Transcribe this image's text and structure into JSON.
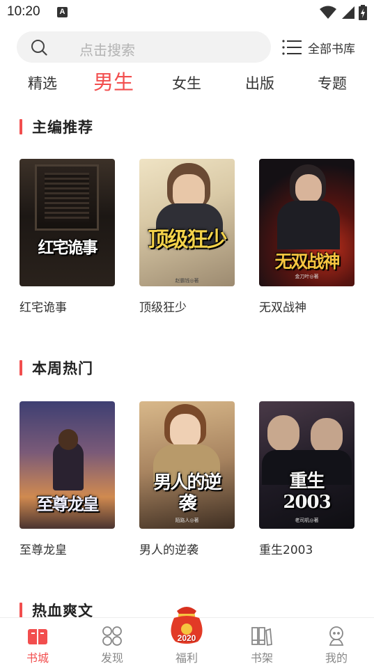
{
  "status_bar": {
    "time": "10:20",
    "notification_letter": "A"
  },
  "search": {
    "placeholder": "点击搜索"
  },
  "library_button": {
    "label": "全部书库"
  },
  "tabs": [
    {
      "label": "精选",
      "active": false
    },
    {
      "label": "男生",
      "active": true
    },
    {
      "label": "女生",
      "active": false
    },
    {
      "label": "出版",
      "active": false
    },
    {
      "label": "专题",
      "active": false
    }
  ],
  "sections": [
    {
      "title": "主编推荐",
      "books": [
        {
          "name": "红宅诡事",
          "cover_title": "红宅诡事",
          "cover_colors": [
            "#2a2420",
            "#6a5a4a"
          ]
        },
        {
          "name": "顶级狂少",
          "cover_title": "顶级狂少",
          "cover_author": "赵霸钱◎著",
          "cover_colors": [
            "#e8dcc0",
            "#7a6a58"
          ]
        },
        {
          "name": "无双战神",
          "cover_title": "无双战神",
          "cover_author": "金刀叶◎著",
          "cover_colors": [
            "#1a1416",
            "#8a1e14"
          ]
        }
      ]
    },
    {
      "title": "本周热门",
      "books": [
        {
          "name": "至尊龙皇",
          "cover_title": "至尊龙皇",
          "cover_colors": [
            "#3a3a6a",
            "#c87a48"
          ]
        },
        {
          "name": "男人的逆袭",
          "cover_title": "男人的逆袭",
          "cover_author": "陌路人◎著",
          "cover_colors": [
            "#c8a678",
            "#4a3828"
          ]
        },
        {
          "name": "重生2003",
          "cover_title": "重生2003",
          "cover_author": "老司机◎著",
          "cover_colors": [
            "#1a1a22",
            "#5a4a58"
          ]
        }
      ]
    },
    {
      "title": "热血爽文",
      "books": []
    }
  ],
  "bottom_nav": [
    {
      "label": "书城",
      "icon": "book-icon",
      "active": true
    },
    {
      "label": "发现",
      "icon": "discover-icon",
      "active": false
    },
    {
      "label": "福利",
      "icon": "lucky-bag-icon",
      "badge": "2020",
      "active": false
    },
    {
      "label": "书架",
      "icon": "bookshelf-icon",
      "active": false
    },
    {
      "label": "我的",
      "icon": "profile-icon",
      "active": false
    }
  ],
  "colors": {
    "accent": "#f24e4e",
    "text": "#333333",
    "muted": "#888888",
    "search_bg": "#f2f2f2"
  }
}
